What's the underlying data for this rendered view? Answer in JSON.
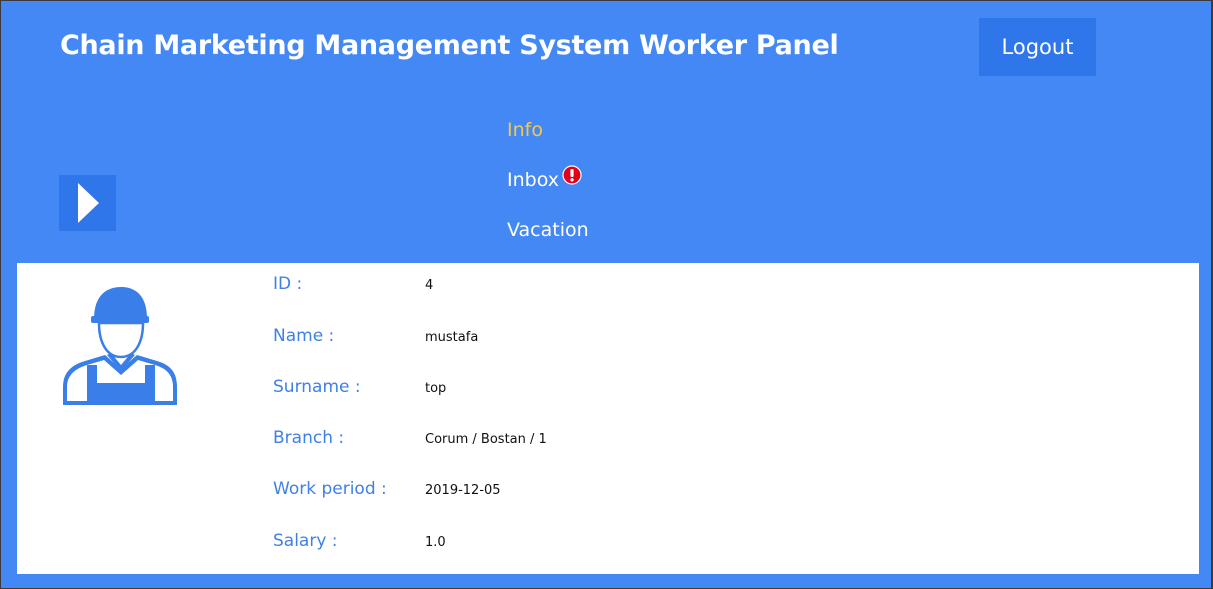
{
  "header": {
    "title": "Chain Marketing Management System Worker Panel",
    "logout_label": "Logout"
  },
  "nav": {
    "items": [
      {
        "label": "Info",
        "active": true
      },
      {
        "label": "Inbox",
        "active": false,
        "alert": true
      },
      {
        "label": "Vacation",
        "active": false
      }
    ]
  },
  "profile": {
    "fields": [
      {
        "label": "ID :",
        "value": "4"
      },
      {
        "label": "Name :",
        "value": "mustafa"
      },
      {
        "label": "Surname :",
        "value": "top"
      },
      {
        "label": "Branch :",
        "value": "Corum / Bostan / 1"
      },
      {
        "label": "Work period :",
        "value": "2019-12-05"
      },
      {
        "label": "Salary :",
        "value": "1.0"
      }
    ]
  },
  "icons": {
    "menu_toggle": "play-arrow-icon",
    "alert": "exclamation-alert-icon",
    "avatar": "worker-avatar-icon"
  },
  "colors": {
    "header_bg": "#4488f5",
    "button_bg": "#2f76ea",
    "active_nav": "#f4c84a",
    "label": "#3f80e6",
    "alert": "#e3001b"
  }
}
